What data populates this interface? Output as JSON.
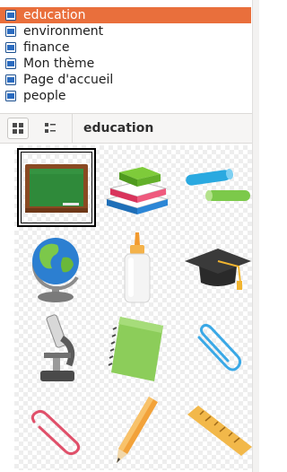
{
  "themes": {
    "items": [
      {
        "label": "education",
        "selected": true
      },
      {
        "label": "environment",
        "selected": false
      },
      {
        "label": "finance",
        "selected": false
      },
      {
        "label": "Mon thème",
        "selected": false
      },
      {
        "label": "Page d'accueil",
        "selected": false
      },
      {
        "label": "people",
        "selected": false
      }
    ]
  },
  "toolbar": {
    "icon_view_icon": "icon-view-icon",
    "list_view_icon": "list-view-icon",
    "title": "education"
  },
  "gallery": {
    "selected_index": 0,
    "items": [
      {
        "icon": "chalkboard-icon"
      },
      {
        "icon": "books-stack-icon"
      },
      {
        "icon": "chalk-icon"
      },
      {
        "icon": "globe-icon"
      },
      {
        "icon": "glue-bottle-icon"
      },
      {
        "icon": "graduation-cap-icon"
      },
      {
        "icon": "microscope-icon"
      },
      {
        "icon": "notebook-icon"
      },
      {
        "icon": "paperclip-blue-icon"
      },
      {
        "icon": "paperclip-red-icon"
      },
      {
        "icon": "pencil-icon"
      },
      {
        "icon": "ruler-icon"
      }
    ]
  },
  "colors": {
    "selection": "#e96f3c"
  }
}
